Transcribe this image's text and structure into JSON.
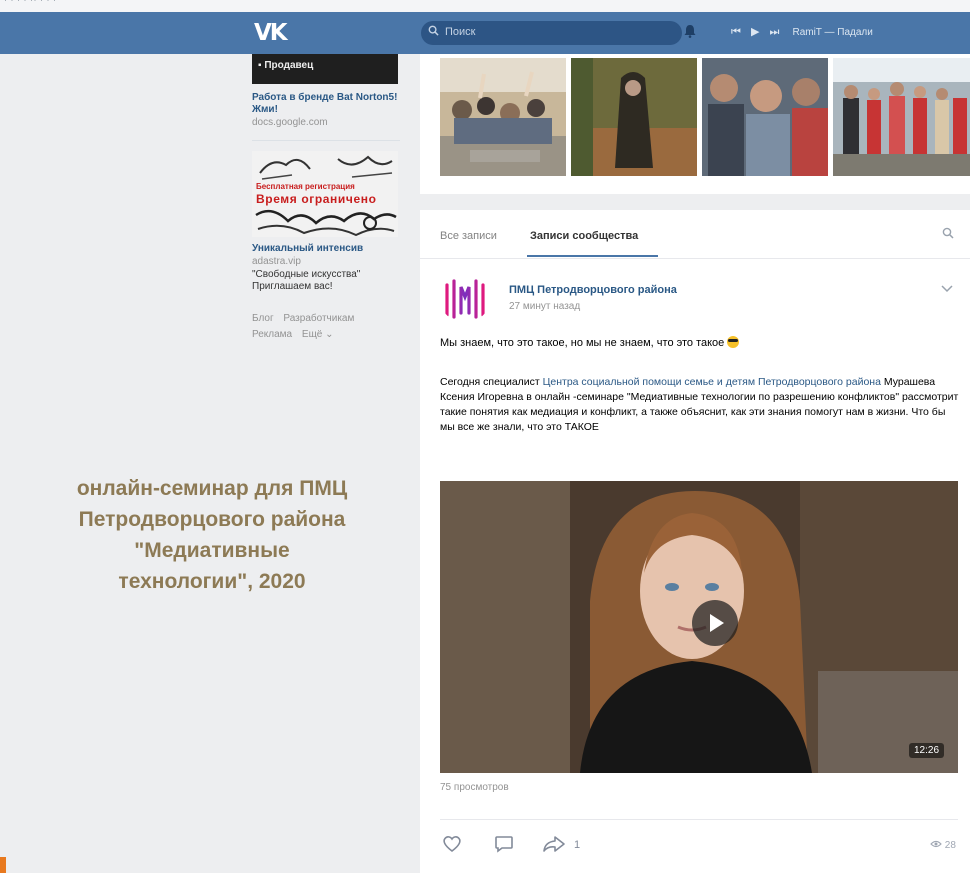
{
  "top_strip": {
    "text": "· · · · ·· · · ·"
  },
  "header": {
    "logo": "VK",
    "search_placeholder": "Поиск",
    "player": {
      "prev": "⏮",
      "play": "▶",
      "next": "⏭",
      "track": "RamiT — Падали"
    }
  },
  "left_column": {
    "ad1": {
      "image_text": "▪ Продавец",
      "title": "Работа в бренде Bat Norton5! Жми!",
      "domain": "docs.google.com"
    },
    "ad2": {
      "image_line1": "Бесплатная регистрация",
      "image_line2": "Время ограничено",
      "title": "Уникальный интенсив",
      "domain": "adastra.vip",
      "description": "\"Свободные искусства\" Приглашаем вас!"
    },
    "footer_links": [
      "Блог",
      "Разработчикам",
      "Реклама",
      "Ещё ⌄"
    ]
  },
  "caption": {
    "line1": "онлайн-семинар для ПМЦ",
    "line2": "Петродворцового района",
    "line3": "\"Медиативные",
    "line4": "технологии\", 2020"
  },
  "tabs": {
    "all": "Все записи",
    "community": "Записи сообщества"
  },
  "post": {
    "author": "ПМЦ Петродворцового района",
    "time": "27 минут назад",
    "line1": "Мы знаем, что это такое, но мы не знаем, что это такое",
    "body_part1": "Сегодня специалист ",
    "body_link": "Центра социальной помощи семье и детям Петродворцового района",
    "body_part2": " Мурашева Ксения Игоревна в онлайн -семинаре \"Медиативные технологии по разрешению конфликтов\" рассмотрит такие понятия как медиация и конфликт, а также объяснит, как эти знания помогут нам в жизни. Что бы мы все же знали, что это ТАКОЕ",
    "video_duration": "12:26",
    "views": "75 просмотров",
    "share_count": "1",
    "views_count": "28"
  },
  "colors": {
    "header_bg": "#4a76a8",
    "link": "#2a5885",
    "caption": "#8d7a55",
    "accent_marker": "#e8791f"
  }
}
